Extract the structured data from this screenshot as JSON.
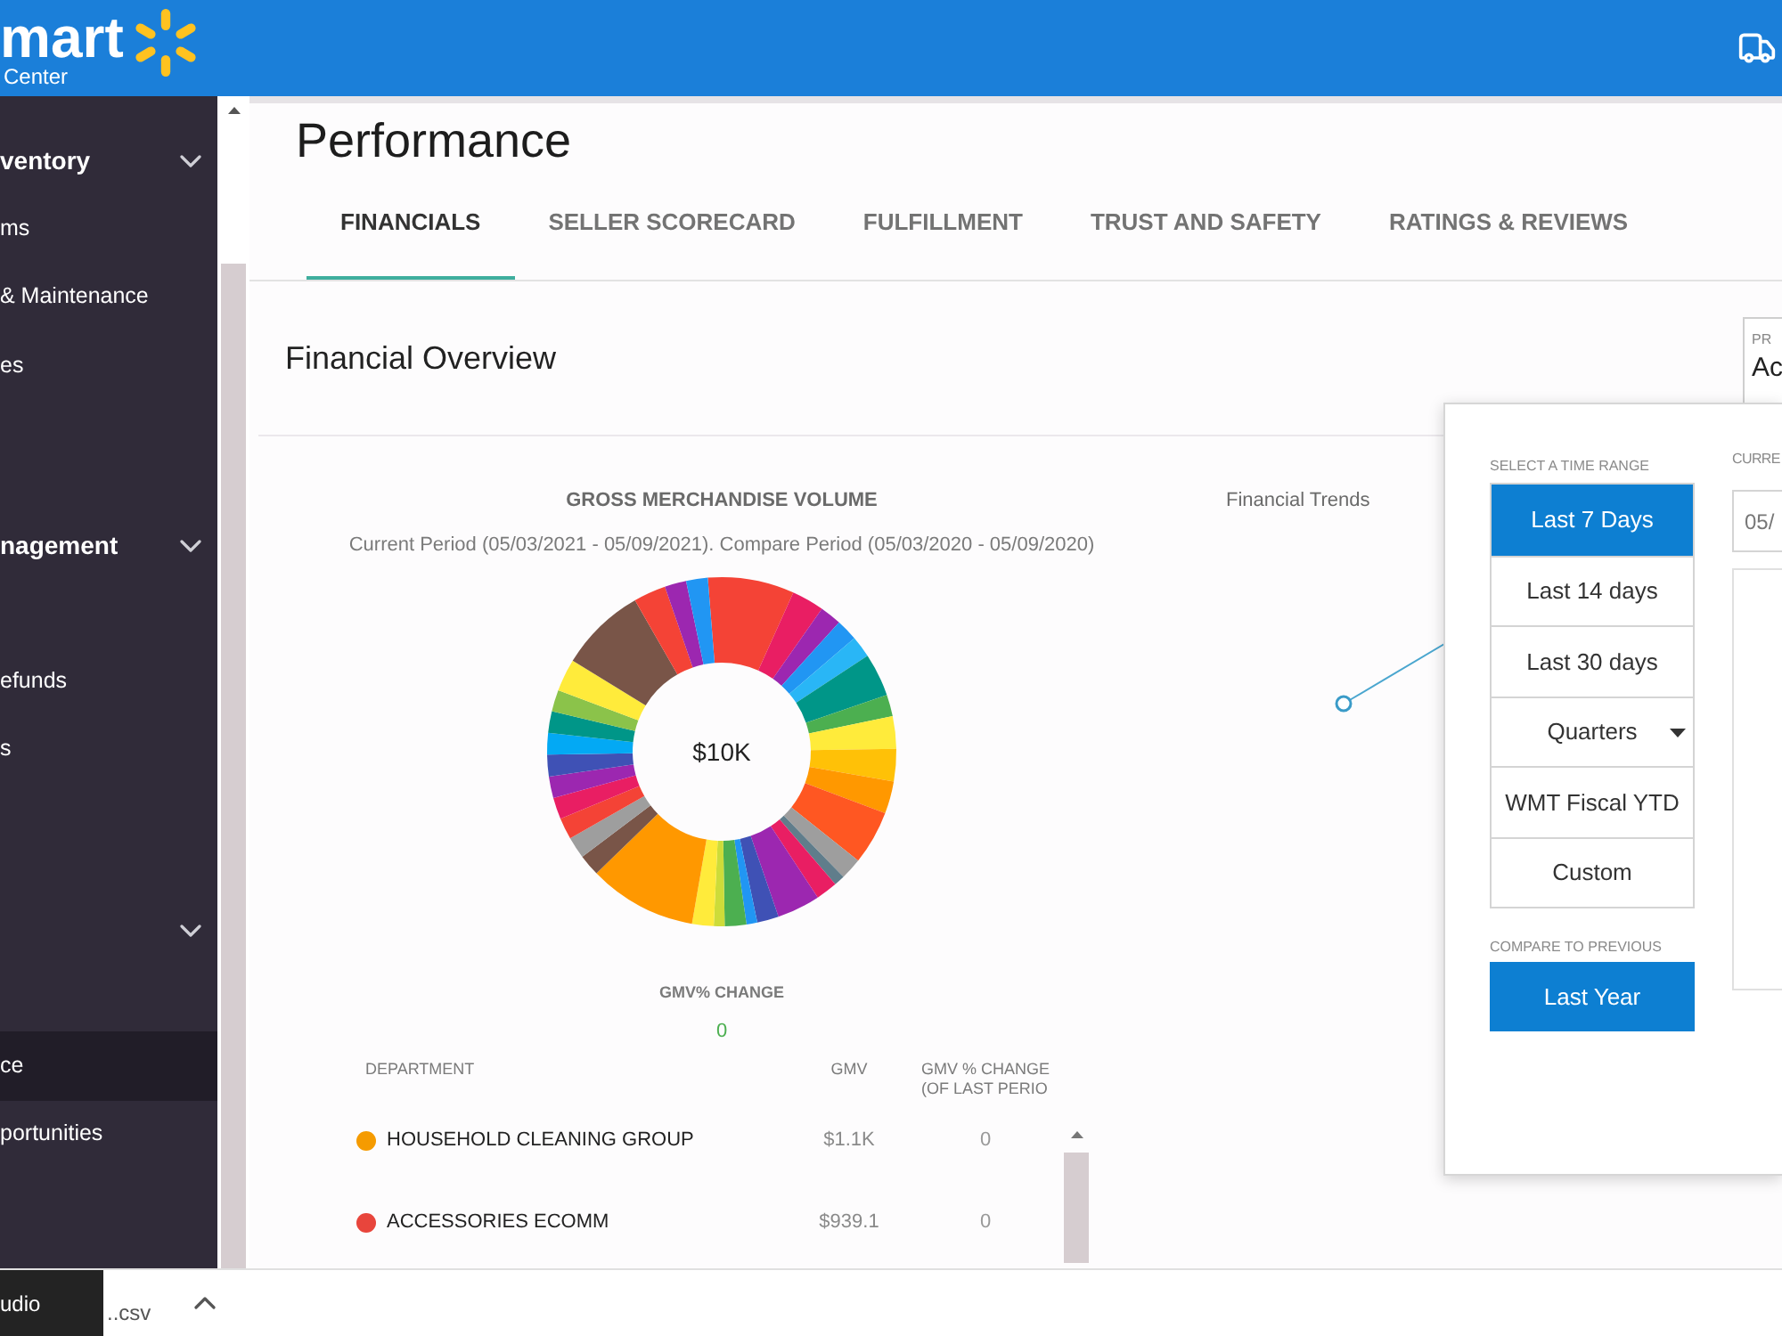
{
  "header": {
    "logo": {
      "wordmark": "mart",
      "subtitle": "Center"
    }
  },
  "sidebar": {
    "groups": [
      {
        "label": "ventory",
        "items": [
          {
            "label": "ms",
            "selected": false
          },
          {
            "label": "& Maintenance",
            "selected": false
          },
          {
            "label": "es",
            "selected": false
          }
        ]
      },
      {
        "label": "nagement",
        "items": [
          {
            "label": "efunds",
            "selected": false
          },
          {
            "label": "s",
            "selected": false
          }
        ]
      },
      {
        "items": [
          {
            "label": "ce",
            "selected": true
          },
          {
            "label": "portunities",
            "selected": false
          }
        ]
      }
    ]
  },
  "page": {
    "title": "Performance"
  },
  "tabs": [
    {
      "label": "FINANCIALS",
      "selected": true
    },
    {
      "label": "SELLER SCORECARD",
      "selected": false
    },
    {
      "label": "FULFILLMENT",
      "selected": false
    },
    {
      "label": "TRUST AND SAFETY",
      "selected": false
    },
    {
      "label": "RATINGS & REVIEWS",
      "selected": false
    }
  ],
  "financial_overview": {
    "title": "Financial Overview",
    "program_field": {
      "label": "PR",
      "value": "Ac"
    }
  },
  "gmv_chart": {
    "title": "GROSS MERCHANDISE VOLUME",
    "subtitle": "Current Period (05/03/2021 - 05/09/2021). Compare Period (05/03/2020 - 05/09/2020)",
    "center_label": "$10K"
  },
  "gmv_change": {
    "label": "GMV% CHANGE",
    "value": "0"
  },
  "department_table": {
    "columns": [
      "DEPARTMENT",
      "GMV",
      "GMV % CHANGE (OF LAST PERIO"
    ],
    "rows": [
      {
        "color": "#f59b00",
        "department": "HOUSEHOLD CLEANING GROUP",
        "gmv": "$1.1K",
        "change": "0"
      },
      {
        "color": "#e8453c",
        "department": "ACCESSORIES ECOMM",
        "gmv": "$939.1",
        "change": "0"
      }
    ]
  },
  "financial_trends": {
    "title": "Financial Trends"
  },
  "time_range_picker": {
    "label": "SELECT A TIME RANGE",
    "options": [
      {
        "label": "Last 7 Days",
        "selected": true,
        "kind": "option"
      },
      {
        "label": "Last 14 days",
        "selected": false,
        "kind": "option"
      },
      {
        "label": "Last 30 days",
        "selected": false,
        "kind": "option"
      },
      {
        "label": "Quarters",
        "selected": false,
        "kind": "dropdown"
      },
      {
        "label": "WMT Fiscal YTD",
        "selected": false,
        "kind": "option"
      },
      {
        "label": "Custom",
        "selected": false,
        "kind": "option"
      }
    ],
    "compare_label": "COMPARE TO PREVIOUS",
    "compare_button": "Last Year",
    "current_label": "CURRE",
    "current_value": "05/"
  },
  "download_bar": {
    "items": [
      {
        "label": "udio"
      },
      {
        "label": "..csv"
      }
    ]
  }
}
